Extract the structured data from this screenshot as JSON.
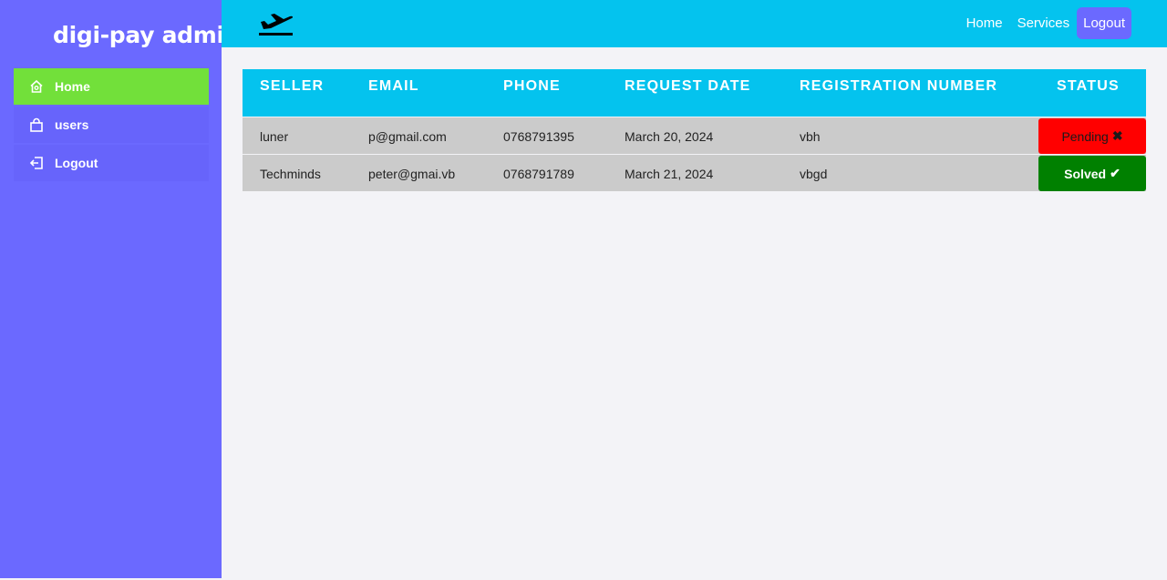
{
  "sidebar": {
    "brand": "digi-pay admin",
    "items": [
      {
        "label": "Home",
        "icon": "home-icon",
        "active": true
      },
      {
        "label": "users",
        "icon": "bag-icon",
        "active": false
      },
      {
        "label": "Logout",
        "icon": "logout-icon",
        "active": false
      }
    ]
  },
  "topbar": {
    "logo_icon": "airplane-takeoff-icon",
    "nav": {
      "home": "Home",
      "services": "Services",
      "logout": "Logout"
    }
  },
  "table": {
    "headers": [
      "SELLER",
      "EMAIL",
      "PHONE",
      "REQUEST DATE",
      "REGISTRATION NUMBER",
      "STATUS"
    ],
    "rows": [
      {
        "seller": "luner",
        "email": "p@gmail.com",
        "phone": "0768791395",
        "date": "March 20, 2024",
        "reg": "vbh",
        "status": "Pending",
        "status_icon": "✖"
      },
      {
        "seller": "Techminds",
        "email": "peter@gmai.vb",
        "phone": "0768791789",
        "date": "March 21, 2024",
        "reg": "vbgd",
        "status": "Solved",
        "status_icon": "✔"
      }
    ]
  },
  "colors": {
    "sidebar": "#6b69ff",
    "active": "#72e03a",
    "topbar": "#04c3ee",
    "pending": "#ff0000",
    "solved": "#008000"
  }
}
